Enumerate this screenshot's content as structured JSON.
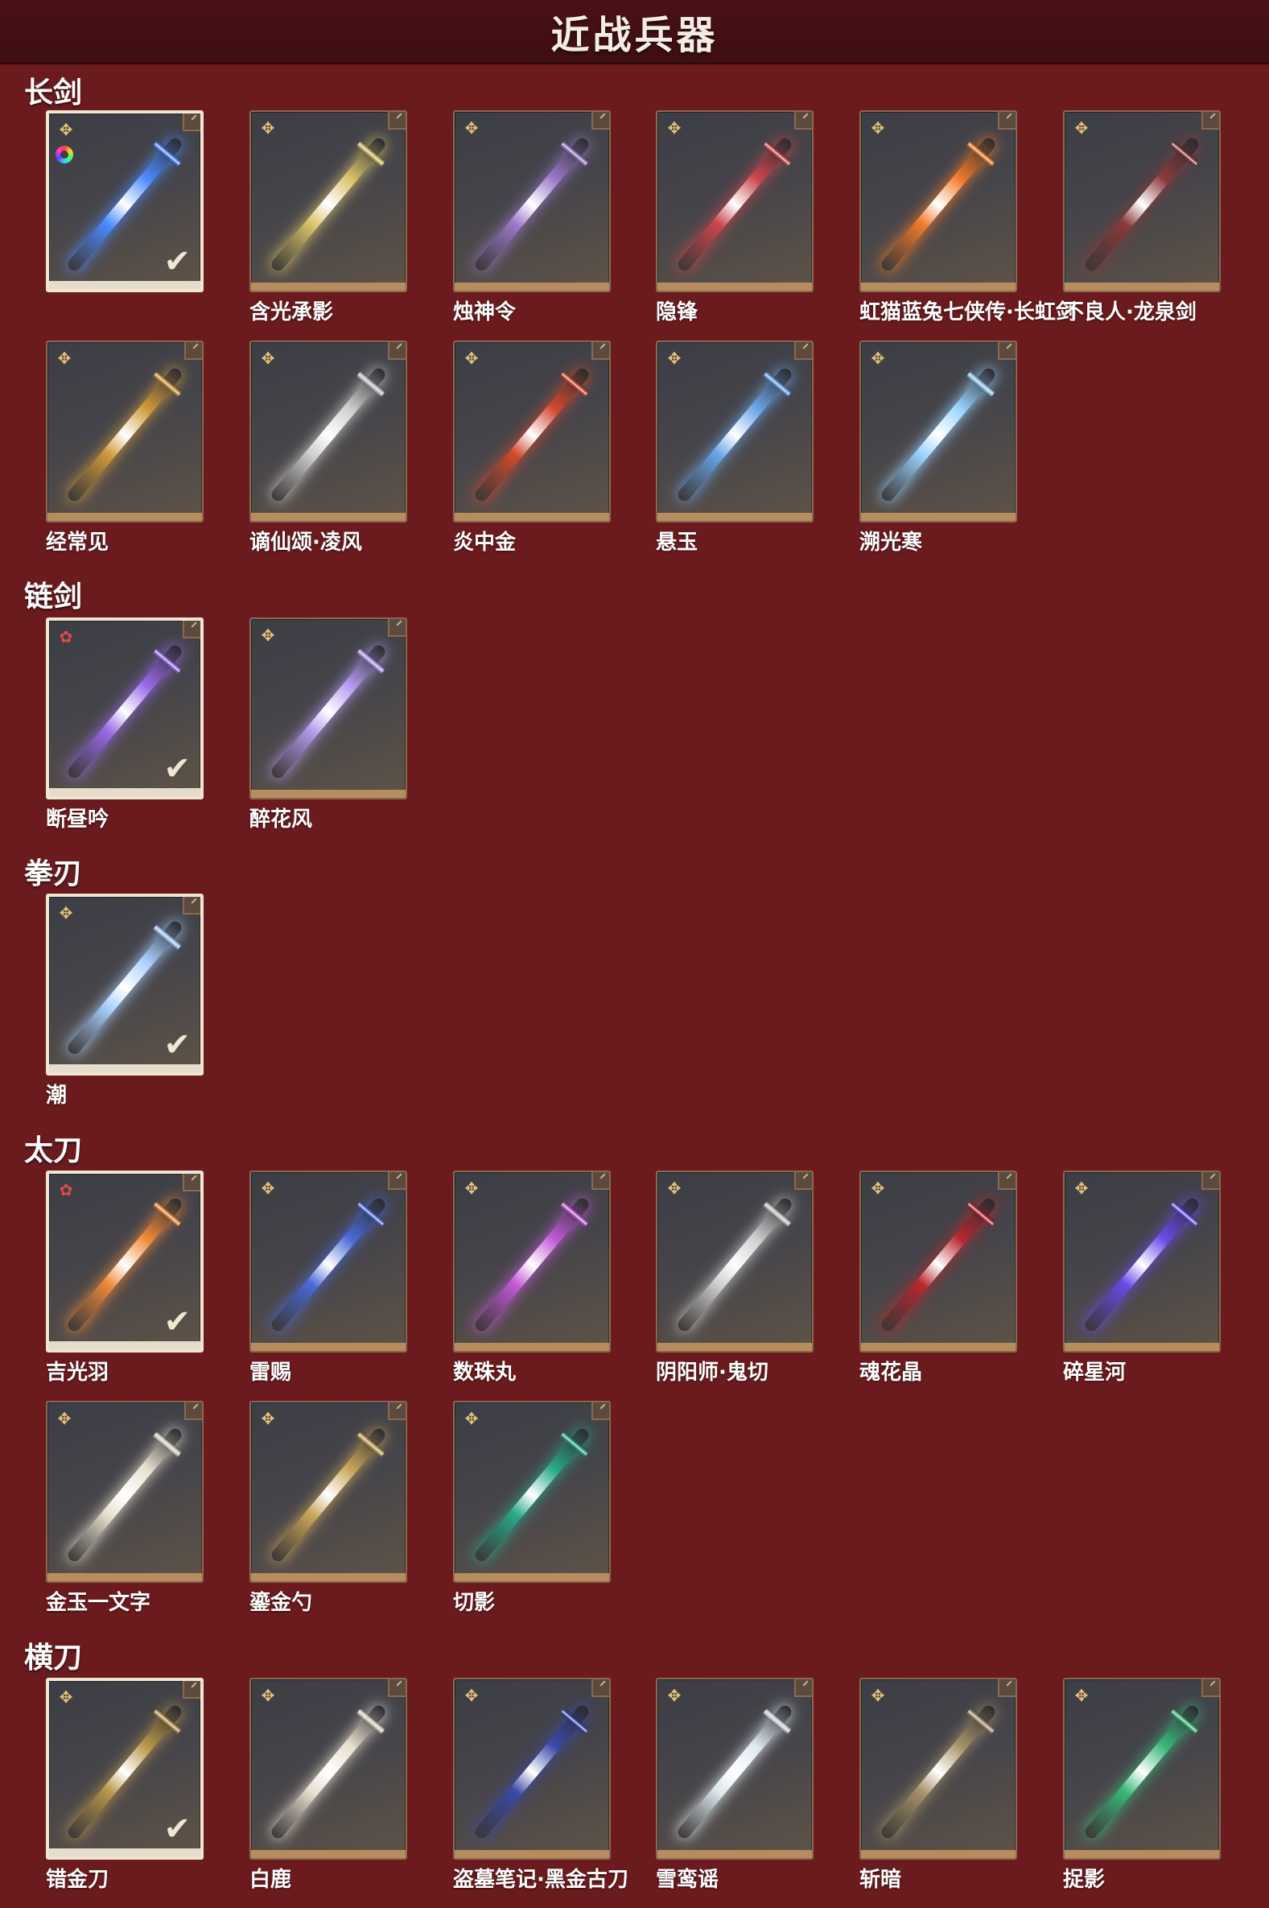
{
  "header": {
    "title": "近战兵器"
  },
  "sections": {
    "longsword": {
      "label": "长剑",
      "items": [
        {
          "name": "",
          "selected": true,
          "rarity": "gold",
          "dye_icon": true,
          "weapon_color": "#4d8bff"
        },
        {
          "name": "含光承影",
          "rarity": "gold",
          "weapon_color": "#d9c46a"
        },
        {
          "name": "烛神令",
          "rarity": "gold",
          "weapon_color": "#9b79c9"
        },
        {
          "name": "隐锋",
          "rarity": "gold",
          "weapon_color": "#c9474c"
        },
        {
          "name": "虹猫蓝兔七侠传·长虹剑",
          "rarity": "gold",
          "weapon_color": "#f07a2a"
        },
        {
          "name": "不良人·龙泉剑",
          "rarity": "gold",
          "weapon_color": "#8a3a3a"
        },
        {
          "name": "经常见",
          "rarity": "gold",
          "weapon_color": "#d09a3c"
        },
        {
          "name": "谪仙颂·凌风",
          "rarity": "gold",
          "weapon_color": "#cfcfcf"
        },
        {
          "name": "炎中金",
          "rarity": "gold",
          "weapon_color": "#d24a2e"
        },
        {
          "name": "悬玉",
          "rarity": "gold",
          "weapon_color": "#6aa6e8"
        },
        {
          "name": "溯光寒",
          "rarity": "gold",
          "weapon_color": "#9ad4ff"
        }
      ]
    },
    "chainsword": {
      "label": "链剑",
      "items": [
        {
          "name": "断昼吟",
          "selected": true,
          "rarity": "red",
          "weapon_color": "#9a6ae8"
        },
        {
          "name": "醉花风",
          "rarity": "gold",
          "weapon_color": "#b59af0"
        }
      ]
    },
    "fistblade": {
      "label": "拳刃",
      "items": [
        {
          "name": "潮",
          "selected": true,
          "rarity": "gold",
          "weapon_color": "#a9d0ff"
        }
      ]
    },
    "tachi": {
      "label": "太刀",
      "items": [
        {
          "name": "吉光羽",
          "selected": true,
          "rarity": "red",
          "weapon_color": "#f08a3a"
        },
        {
          "name": "雷赐",
          "rarity": "gold",
          "weapon_color": "#4a6ad8"
        },
        {
          "name": "数珠丸",
          "rarity": "gold",
          "weapon_color": "#c25ad8"
        },
        {
          "name": "阴阳师·鬼切",
          "rarity": "gold",
          "weapon_color": "#cfcfcf"
        },
        {
          "name": "魂花晶",
          "rarity": "gold",
          "weapon_color": "#b8282e"
        },
        {
          "name": "碎星河",
          "rarity": "gold",
          "weapon_color": "#6a4ae8"
        },
        {
          "name": "金玉一文字",
          "rarity": "gold",
          "weapon_color": "#e8e2d0"
        },
        {
          "name": "鎏金勺",
          "rarity": "gold",
          "weapon_color": "#c9a65a"
        },
        {
          "name": "切影",
          "rarity": "gold",
          "weapon_color": "#2aa88a"
        }
      ]
    },
    "hengdao": {
      "label": "横刀",
      "items": [
        {
          "name": "错金刀",
          "selected": true,
          "rarity": "gold",
          "weapon_color": "#b8964a"
        },
        {
          "name": "白鹿",
          "rarity": "gold",
          "weapon_color": "#e8e0d0"
        },
        {
          "name": "盗墓笔记·黑金古刀",
          "rarity": "gold",
          "weapon_color": "#3a4aa8"
        },
        {
          "name": "雪鸾谣",
          "rarity": "gold",
          "weapon_color": "#dfe8ef"
        },
        {
          "name": "斩暗",
          "rarity": "gold",
          "weapon_color": "#a8946a"
        },
        {
          "name": "捉影",
          "rarity": "gold",
          "weapon_color": "#3ab87a"
        }
      ]
    }
  },
  "icons": {
    "rarity_gold": "✥",
    "rarity_red": "✿",
    "check": "✔"
  }
}
